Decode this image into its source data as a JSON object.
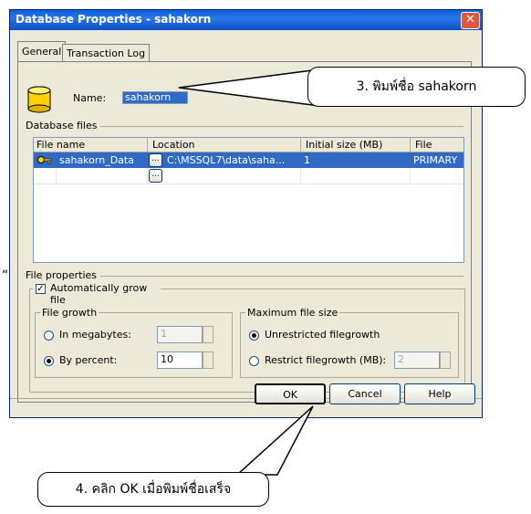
{
  "window": {
    "title": "Database Properties - sahakorn",
    "close_glyph": "✕"
  },
  "tabs": [
    {
      "label": "General"
    },
    {
      "label": "Transaction Log"
    }
  ],
  "name_field": {
    "label": "Name:",
    "value": "sahakorn"
  },
  "database_files": {
    "group_label": "Database files",
    "columns": [
      "File name",
      "Location",
      "Initial size (MB)",
      "File group"
    ],
    "rows": [
      {
        "file_name": "sahakorn_Data",
        "browse": "...",
        "location": "C:\\MSSQL7\\data\\saha...",
        "size": "1",
        "group": "PRIMARY"
      },
      {
        "file_name": "",
        "browse": "...",
        "location": "",
        "size": "",
        "group": ""
      }
    ]
  },
  "file_properties": {
    "group_label": "File properties",
    "auto_grow_label": "Automatically grow file",
    "auto_grow_checked": true,
    "file_growth": {
      "group_label": "File growth",
      "in_mb_label": "In megabytes:",
      "in_mb_value": "1",
      "by_percent_label": "By percent:",
      "by_percent_value": "10",
      "selected": "by_percent"
    },
    "max_size": {
      "group_label": "Maximum file size",
      "unrestricted_label": "Unrestricted filegrowth",
      "restrict_label": "Restrict filegrowth (MB):",
      "restrict_value": "2",
      "selected": "unrestricted"
    }
  },
  "buttons": {
    "ok": "OK",
    "cancel": "Cancel",
    "help": "Help"
  },
  "callouts": {
    "step3": "3. พิมพ์ชื่อ sahakorn",
    "step4": "4. คลิก OK เมื่อพิมพ์ชื่อเสร็จ"
  },
  "stray_mark": "“"
}
